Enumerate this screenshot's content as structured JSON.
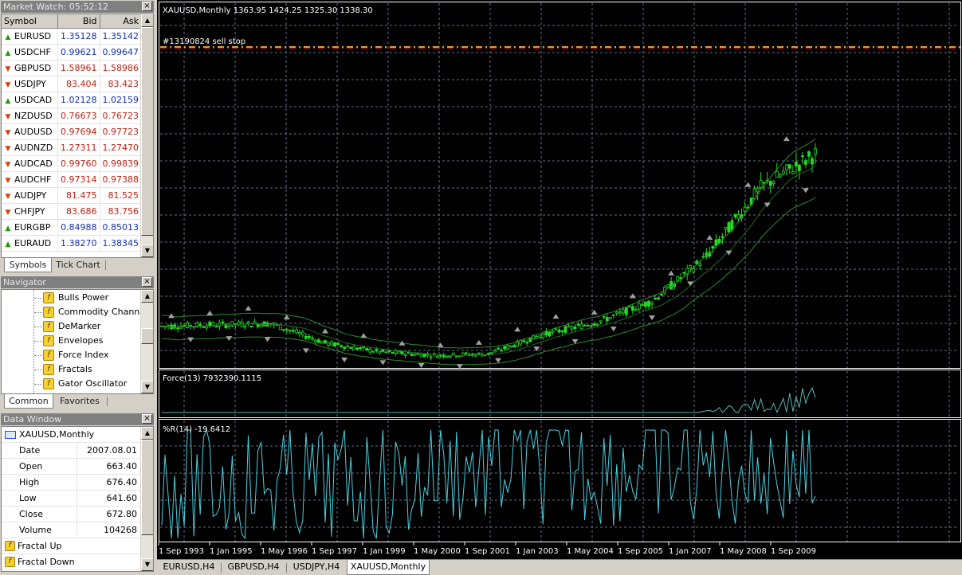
{
  "market_watch": {
    "title": "Market Watch: 05:52:12",
    "columns": [
      "Symbol",
      "Bid",
      "Ask"
    ],
    "rows": [
      {
        "symbol": "EURUSD",
        "bid": "1.35128",
        "ask": "1.35142",
        "dir": "up"
      },
      {
        "symbol": "USDCHF",
        "bid": "0.99621",
        "ask": "0.99647",
        "dir": "up"
      },
      {
        "symbol": "GBPUSD",
        "bid": "1.58961",
        "ask": "1.58986",
        "dir": "down"
      },
      {
        "symbol": "USDJPY",
        "bid": "83.404",
        "ask": "83.423",
        "dir": "down"
      },
      {
        "symbol": "USDCAD",
        "bid": "1.02128",
        "ask": "1.02159",
        "dir": "up"
      },
      {
        "symbol": "NZDUSD",
        "bid": "0.76673",
        "ask": "0.76723",
        "dir": "down"
      },
      {
        "symbol": "AUDUSD",
        "bid": "0.97694",
        "ask": "0.97723",
        "dir": "down"
      },
      {
        "symbol": "AUDNZD",
        "bid": "1.27311",
        "ask": "1.27470",
        "dir": "down"
      },
      {
        "symbol": "AUDCAD",
        "bid": "0.99760",
        "ask": "0.99839",
        "dir": "down"
      },
      {
        "symbol": "AUDCHF",
        "bid": "0.97314",
        "ask": "0.97388",
        "dir": "down"
      },
      {
        "symbol": "AUDJPY",
        "bid": "81.475",
        "ask": "81.525",
        "dir": "down"
      },
      {
        "symbol": "CHFJPY",
        "bid": "83.686",
        "ask": "83.756",
        "dir": "down"
      },
      {
        "symbol": "EURGBP",
        "bid": "0.84988",
        "ask": "0.85013",
        "dir": "up"
      },
      {
        "symbol": "EURAUD",
        "bid": "1.38270",
        "ask": "1.38345",
        "dir": "up"
      }
    ],
    "tabs": [
      "Symbols",
      "Tick Chart"
    ]
  },
  "navigator": {
    "title": "Navigator",
    "items": [
      "Bulls Power",
      "Commodity Channel Ir",
      "DeMarker",
      "Envelopes",
      "Force Index",
      "Fractals",
      "Gator Oscillator"
    ],
    "tabs": [
      "Common",
      "Favorites"
    ]
  },
  "data_window": {
    "title": "Data Window",
    "symbol": "XAUUSD,Monthly",
    "rows": [
      {
        "key": "Date",
        "value": "2007.08.01"
      },
      {
        "key": "Open",
        "value": "663.40"
      },
      {
        "key": "High",
        "value": "676.40"
      },
      {
        "key": "Low",
        "value": "641.60"
      },
      {
        "key": "Close",
        "value": "672.80"
      },
      {
        "key": "Volume",
        "value": "104268"
      }
    ],
    "indicators": [
      "Fractal Up",
      "Fractal Down"
    ]
  },
  "chart": {
    "header": "XAUUSD,Monthly  1363.95 1424.25 1325.30 1338.30",
    "order_label": "#13190824 sell stop",
    "force_label": "Force(13) 7932390.1115",
    "wpr_label": "%R(14) -19.6412",
    "x_labels": [
      "1 Sep 1993",
      "1 Jan 1995",
      "1 May 1996",
      "1 Sep 1997",
      "1 Jan 1999",
      "1 May 2000",
      "1 Sep 2001",
      "1 Jan 2003",
      "1 May 2004",
      "1 Sep 2005",
      "1 Jan 2007",
      "1 May 2008",
      "1 Sep 2009"
    ],
    "colors": {
      "background": "#000000",
      "candles": "#22dd22",
      "grid": "#6a6a8a",
      "force": "#5fb5b5",
      "wpr": "#4ad0e0",
      "order_line": "#e8a020",
      "order_line2": "#cc2020",
      "fractal": "#a0a0a0"
    }
  },
  "chart_tabs": [
    "EURUSD,H4",
    "GBPUSD,H4",
    "USDJPY,H4",
    "XAUUSD,Monthly"
  ],
  "chart_data": {
    "type": "line",
    "title": "XAUUSD,Monthly",
    "x": [
      "1 Sep 1993",
      "1 Jan 1995",
      "1 May 1996",
      "1 Sep 1997",
      "1 Jan 1999",
      "1 May 2000",
      "1 Sep 2001",
      "1 Jan 2003",
      "1 May 2004",
      "1 Sep 2005",
      "1 Jan 2007",
      "1 May 2008",
      "1 Sep 2009"
    ],
    "series": [
      {
        "values": [
          380,
          385,
          390,
          320,
          288,
          275,
          280,
          350,
          395,
          470,
          630,
          880,
          1000
        ]
      }
    ],
    "grid": true
  }
}
